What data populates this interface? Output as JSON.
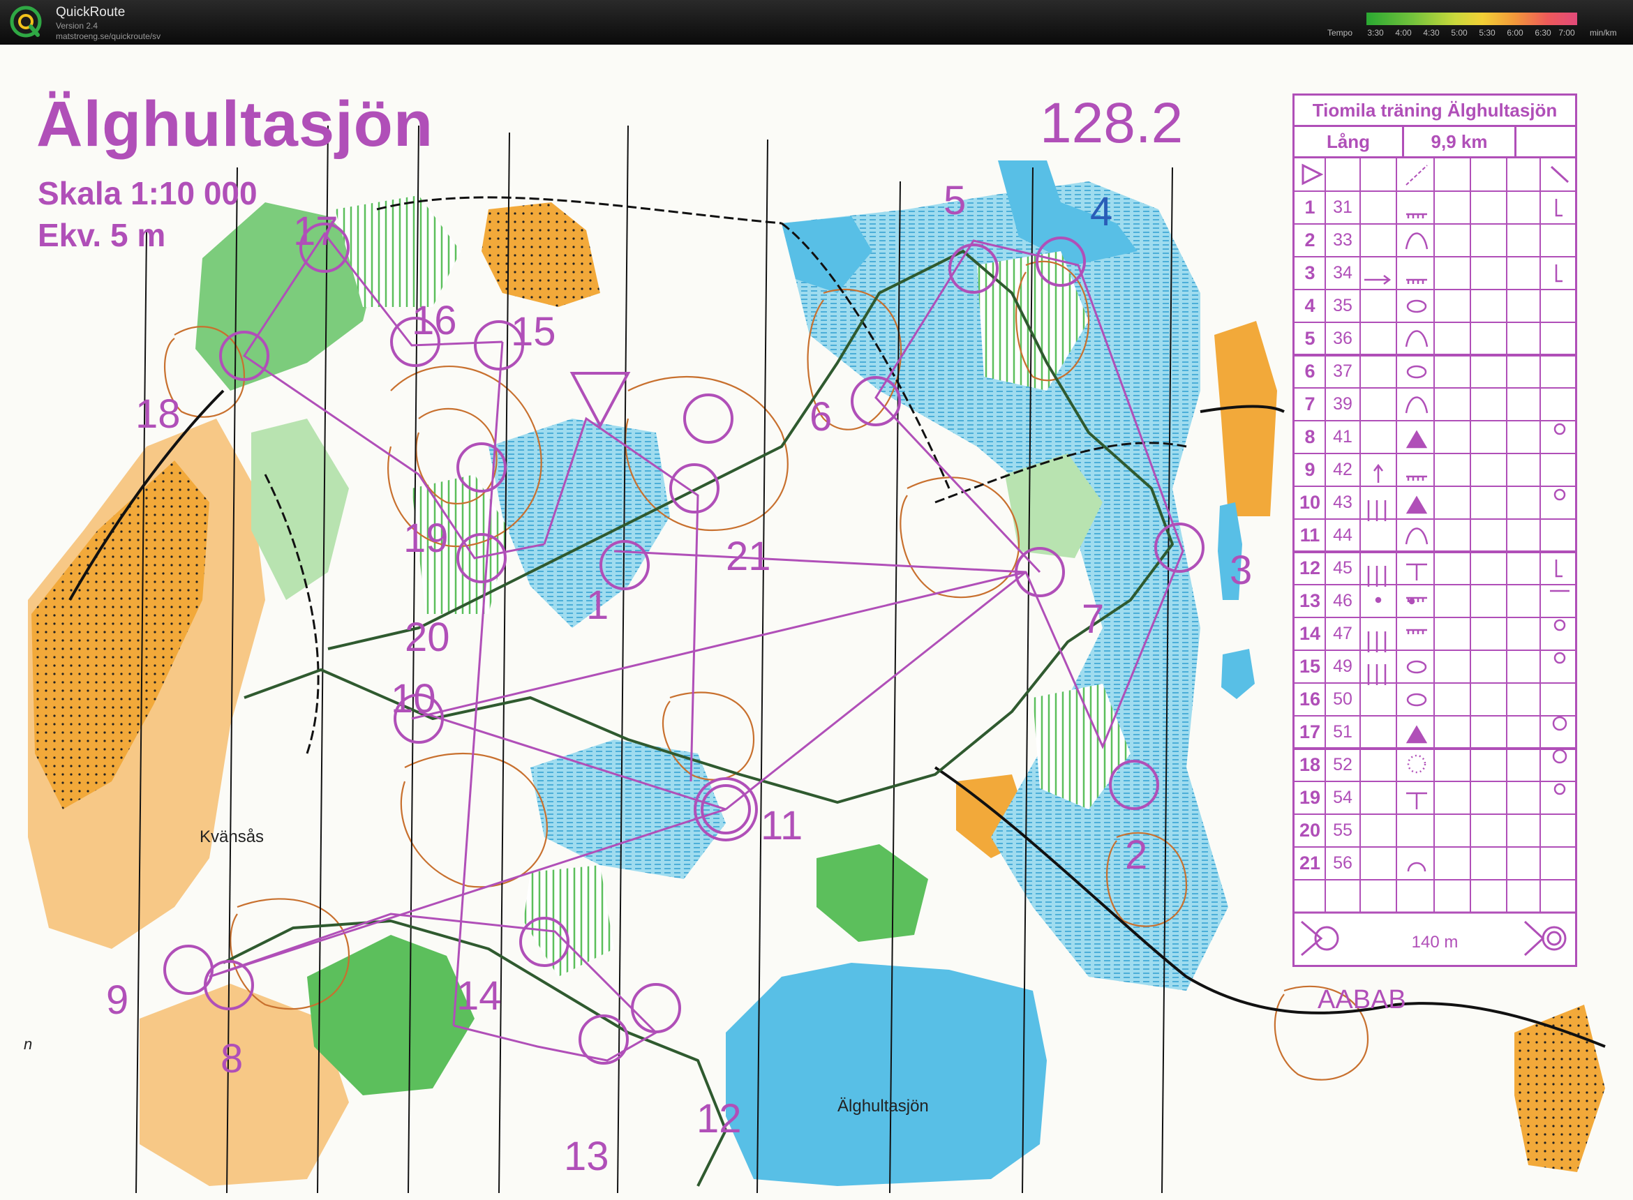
{
  "app": {
    "name": "QuickRoute",
    "version": "Version 2.4",
    "url": "matstroeng.se/quickroute/sv",
    "tempo_label": "Tempo",
    "tempo_ticks": [
      "3:30",
      "4:00",
      "4:30",
      "5:00",
      "5:30",
      "6:00",
      "6:30",
      "7:00"
    ],
    "tempo_unit": "min/km"
  },
  "map": {
    "title": "Älghultasjön",
    "scale": "Skala 1:10 000",
    "equidistance": "Ekv. 5 m",
    "course_code": "128.2",
    "lake_name": "Älghultasjön",
    "place_name": "Kvänsås",
    "company": "AABAB",
    "margin_note": "n",
    "control_labels": [
      "1",
      "2",
      "3",
      "4",
      "5",
      "6",
      "7",
      "8",
      "9",
      "10",
      "11",
      "12",
      "13",
      "14",
      "15",
      "16",
      "17",
      "18",
      "19",
      "20",
      "21"
    ],
    "colors": {
      "overprint": "#b04fb8",
      "water": "#58bfe6",
      "open_land": "#f2a93a",
      "vegetation": "#4fb04f",
      "contours": "#c8702e",
      "route": "#2f5a2f"
    }
  },
  "control_descriptions": {
    "title": "Tiomila träning Älghultasjön",
    "course": "Lång",
    "length": "9,9 km",
    "controls": [
      {
        "seq": "1",
        "code": "31"
      },
      {
        "seq": "2",
        "code": "33"
      },
      {
        "seq": "3",
        "code": "34"
      },
      {
        "seq": "4",
        "code": "35"
      },
      {
        "seq": "5",
        "code": "36"
      },
      {
        "seq": "6",
        "code": "37"
      },
      {
        "seq": "7",
        "code": "39"
      },
      {
        "seq": "8",
        "code": "41"
      },
      {
        "seq": "9",
        "code": "42"
      },
      {
        "seq": "10",
        "code": "43"
      },
      {
        "seq": "11",
        "code": "44"
      },
      {
        "seq": "12",
        "code": "45"
      },
      {
        "seq": "13",
        "code": "46"
      },
      {
        "seq": "14",
        "code": "47"
      },
      {
        "seq": "15",
        "code": "49"
      },
      {
        "seq": "16",
        "code": "50"
      },
      {
        "seq": "17",
        "code": "51"
      },
      {
        "seq": "18",
        "code": "52"
      },
      {
        "seq": "19",
        "code": "54"
      },
      {
        "seq": "20",
        "code": "55"
      },
      {
        "seq": "21",
        "code": "56"
      }
    ],
    "finish_distance": "140 m"
  }
}
